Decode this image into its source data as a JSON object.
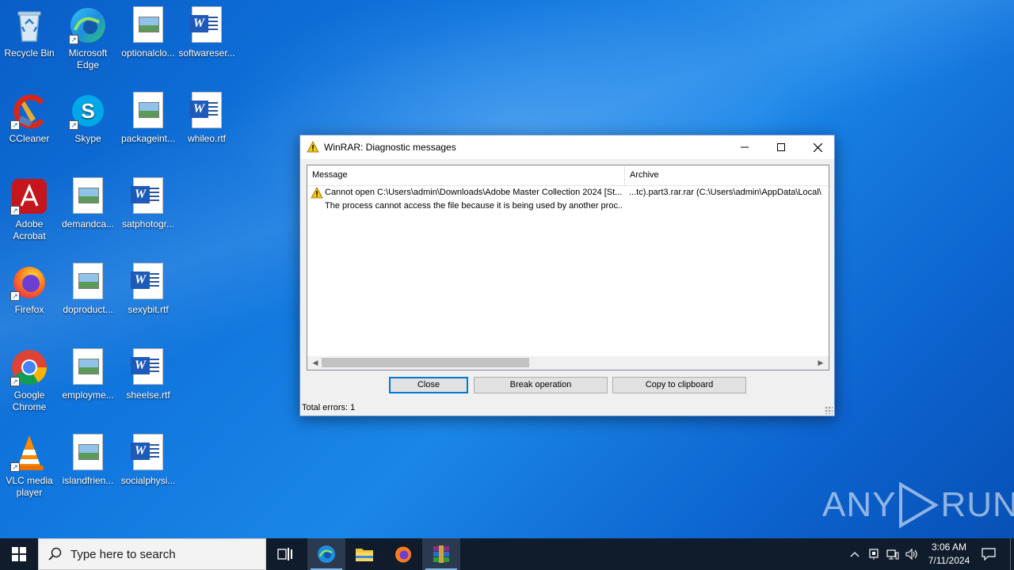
{
  "desktop": {
    "icons": [
      {
        "label": "Recycle Bin"
      },
      {
        "label": "Microsoft Edge"
      },
      {
        "label": "optionalclo..."
      },
      {
        "label": "softwareser..."
      },
      {
        "label": "CCleaner"
      },
      {
        "label": "Skype"
      },
      {
        "label": "packageint..."
      },
      {
        "label": "whileo.rtf"
      },
      {
        "label": "Adobe Acrobat"
      },
      {
        "label": "demandca..."
      },
      {
        "label": "satphotogr..."
      },
      {
        "label": "Firefox"
      },
      {
        "label": "doproduct..."
      },
      {
        "label": "sexybit.rtf"
      },
      {
        "label": "Google Chrome"
      },
      {
        "label": "employme..."
      },
      {
        "label": "sheelse.rtf"
      },
      {
        "label": "VLC media player"
      },
      {
        "label": "islandfrien..."
      },
      {
        "label": "socialphysi..."
      }
    ]
  },
  "dialog": {
    "title": "WinRAR: Diagnostic messages",
    "columns": {
      "message": "Message",
      "archive": "Archive"
    },
    "rows": [
      {
        "message": "Cannot open C:\\Users\\admin\\Downloads\\Adobe Master Collection 2024 [St...",
        "archive": "...tc).part3.rar.rar (C:\\Users\\admin\\AppData\\Local\\"
      },
      {
        "message": "The process cannot access the file because it is being used by another proc...",
        "archive": ""
      }
    ],
    "buttons": {
      "close": "Close",
      "break": "Break operation",
      "copy": "Copy to clipboard"
    },
    "status": "Total errors: 1"
  },
  "watermark": {
    "left": "ANY",
    "right": "RUN"
  },
  "taskbar": {
    "search_placeholder": "Type here to search",
    "clock_time": "3:06 AM",
    "clock_date": "7/11/2024"
  }
}
